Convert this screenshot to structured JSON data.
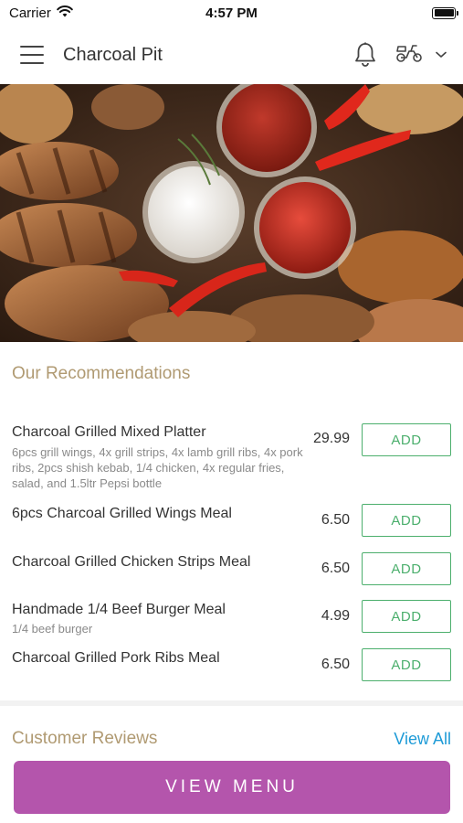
{
  "status_bar": {
    "carrier": "Carrier",
    "time": "4:57 PM",
    "battery_level": 1.0
  },
  "nav": {
    "title": "Charcoal Pit",
    "menu_icon": "hamburger-menu-icon",
    "bell_icon": "bell-icon",
    "delivery_icon": "delivery-scooter-icon",
    "dropdown_icon": "chevron-down-icon"
  },
  "hero": {
    "image_icon": "food-photo"
  },
  "recommendations": {
    "title": "Our Recommendations",
    "add_label": "ADD",
    "items": [
      {
        "name": "Charcoal Grilled Mixed Platter",
        "description": "6pcs grill wings, 4x grill strips, 4x lamb grill ribs, 4x pork ribs, 2pcs shish kebab, 1/4 chicken, 4x regular fries, salad, and 1.5ltr Pepsi bottle",
        "price": "29.99"
      },
      {
        "name": "6pcs Charcoal Grilled Wings Meal",
        "description": "",
        "price": "6.50"
      },
      {
        "name": "Charcoal Grilled Chicken Strips Meal",
        "description": "",
        "price": "6.50"
      },
      {
        "name": "Handmade 1/4 Beef Burger Meal",
        "description": "1/4 beef burger",
        "price": "4.99"
      },
      {
        "name": "Charcoal Grilled Pork Ribs Meal",
        "description": "",
        "price": "6.50"
      }
    ]
  },
  "reviews": {
    "title": "Customer Reviews",
    "view_all_label": "View All"
  },
  "footer": {
    "view_menu_label": "VIEW MENU"
  },
  "colors": {
    "accent_gold": "#b09a72",
    "add_green": "#4caf6d",
    "link_blue": "#1e9bd7",
    "primary_purple": "#b455ac"
  }
}
